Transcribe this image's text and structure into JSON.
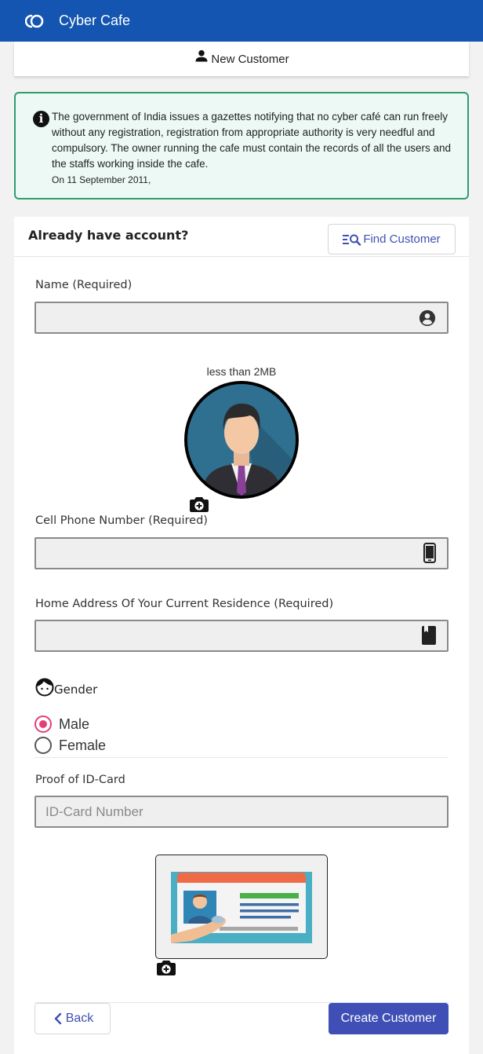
{
  "app": {
    "title": "Cyber Cafe"
  },
  "sub_header": {
    "title": "New Customer"
  },
  "notice": {
    "text": "The government of India issues a gazettes notifying that no cyber café can run freely without any registration, registration from appropriate authority is very needful and compulsory. The owner running the cafe must contain the records of all the users and the staffs working inside the cafe.",
    "date": "On 11 September 2011,"
  },
  "account": {
    "label": "Already have account?",
    "find_button": "Find Customer"
  },
  "form": {
    "name_label": "Name (Required)",
    "name_value": "",
    "photo_note": "less than 2MB",
    "phone_label": "Cell Phone Number (Required)",
    "phone_value": "",
    "address_label": "Home Address Of Your Current Residence (Required)",
    "address_value": "",
    "gender_label": "Gender",
    "gender_options": [
      "Male",
      "Female"
    ],
    "gender_selected": "Male",
    "id_label": "Proof of ID-Card",
    "id_placeholder": "ID-Card Number",
    "id_value": ""
  },
  "actions": {
    "back": "Back",
    "create": "Create Customer"
  },
  "colors": {
    "appbar": "#1355b0",
    "primary": "#3f4fb5",
    "notice_border": "#2e9e6e",
    "notice_bg": "#ecf9f4",
    "radio_accent": "#e33f75"
  },
  "icons": {
    "logo": "cyber-cafe-logo-icon",
    "new_customer": "person-icon",
    "info": "info-icon",
    "find": "list-search-icon",
    "name": "account-circle-icon",
    "photo_upload": "camera-plus-icon",
    "phone": "smartphone-icon",
    "address": "book-icon",
    "gender": "face-icon",
    "back": "chevron-left-icon"
  }
}
